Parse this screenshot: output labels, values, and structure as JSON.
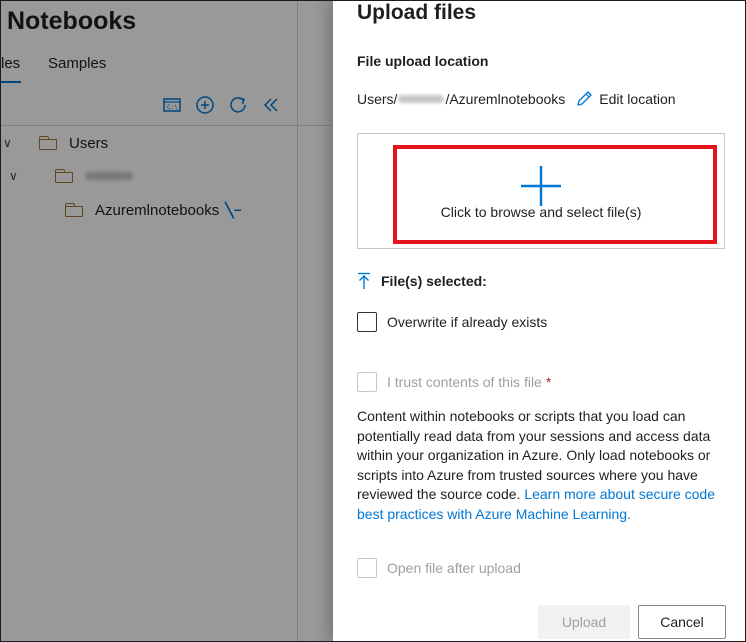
{
  "background_page": {
    "title": "Notebooks",
    "tabs": [
      {
        "label": "les"
      },
      {
        "label": "Samples"
      }
    ],
    "toolbar_icons": [
      "terminal-icon",
      "add-icon",
      "refresh-icon",
      "collapse-icon"
    ],
    "tree": {
      "users_label": "Users",
      "user_folder_label": "",
      "notebook_folder_label": "Azuremlnotebooks"
    }
  },
  "panel": {
    "title": "Upload files",
    "location_label": "File upload location",
    "location_prefix": "Users/",
    "location_suffix": "/Azuremlnotebooks",
    "edit_location": "Edit location",
    "browse_text": "Click to browse and select file(s)",
    "files_selected_label": "File(s) selected:",
    "overwrite_label": "Overwrite if already exists",
    "trust_label": "I trust contents of this file",
    "required_marker": "*",
    "trust_text": "Content within notebooks or scripts that you load can potentially read data from your sessions and access data within your organization in Azure. Only load notebooks or scripts into Azure from trusted sources where you have reviewed the source code.",
    "learn_more_link": "Learn more about secure code best practices with Azure Machine Learning.",
    "open_after_label": "Open file after upload",
    "upload_button": "Upload",
    "cancel_button": "Cancel"
  },
  "colors": {
    "accent": "#0078d4",
    "highlight_box": "#e3141b",
    "folder": "#a1783a"
  }
}
